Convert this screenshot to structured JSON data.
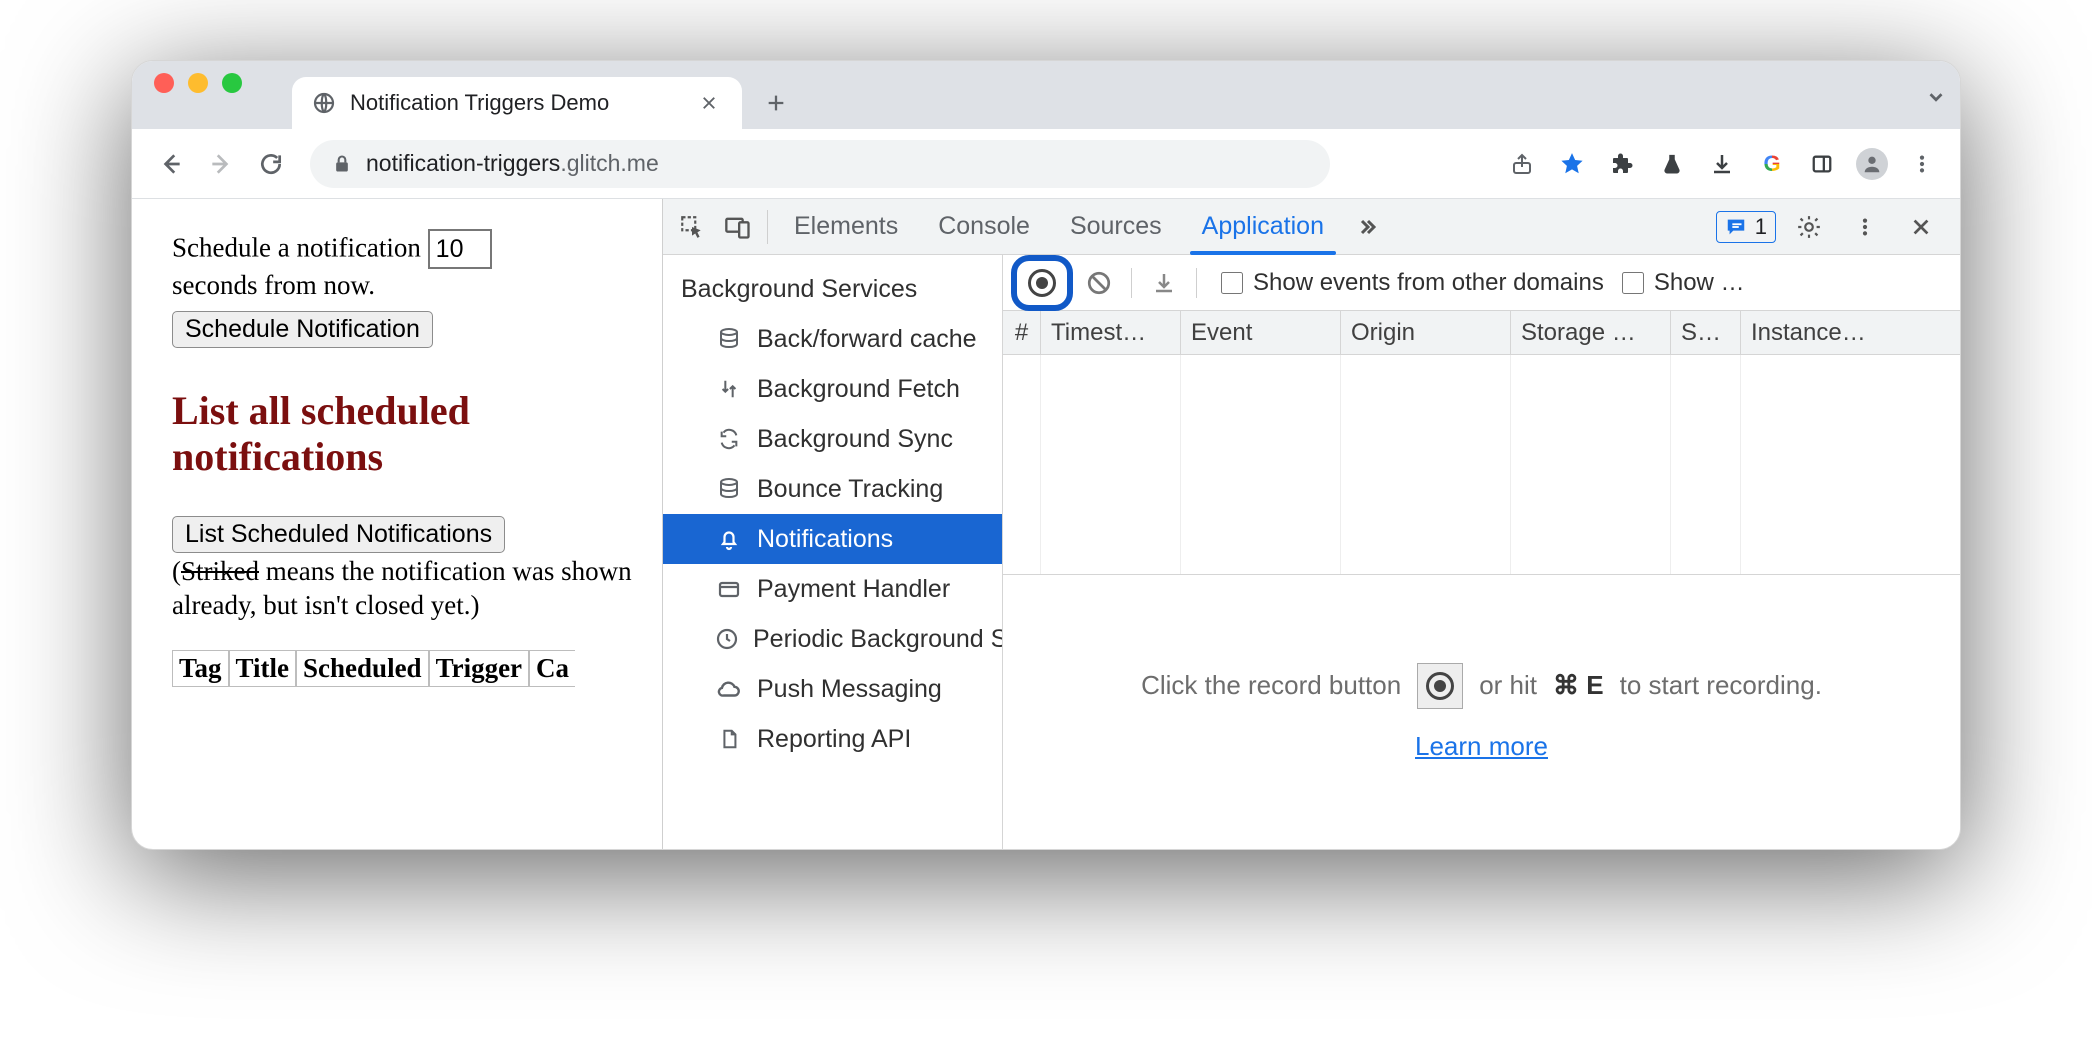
{
  "tab": {
    "title": "Notification Triggers Demo"
  },
  "url": {
    "host": "notification-triggers",
    "suffix": ".glitch.me"
  },
  "page": {
    "sched_prefix": "Schedule a notification",
    "sched_value": "10",
    "sched_suffix": "seconds from now.",
    "btn_schedule": "Schedule Notification",
    "heading": "List all scheduled notifications",
    "btn_list": "List Scheduled Notifications",
    "paren_open": "(",
    "striked": "Striked",
    "desc_rest": " means the notification was shown already, but isn't closed yet.)",
    "table_headers": [
      "Tag",
      "Title",
      "Scheduled",
      "Trigger",
      "Ca"
    ]
  },
  "devtools": {
    "tabs": [
      "Elements",
      "Console",
      "Sources",
      "Application"
    ],
    "active_tab": 3,
    "issues_count": "1",
    "sidebar_category": "Background Services",
    "sidebar_items": [
      "Back/forward cache",
      "Background Fetch",
      "Background Sync",
      "Bounce Tracking",
      "Notifications",
      "Payment Handler",
      "Periodic Background Sync",
      "Push Messaging",
      "Reporting API"
    ],
    "sidebar_active": 4,
    "show_opt1": "Show events from other domains",
    "show_opt2": "Show …",
    "columns": [
      "#",
      "Timest…",
      "Event",
      "Origin",
      "Storage …",
      "S…",
      "Instance…"
    ],
    "hint_before": "Click the record button",
    "hint_after": "or hit",
    "hint_shortcut": "⌘ E",
    "hint_tail": "to start recording.",
    "learn": "Learn more"
  }
}
